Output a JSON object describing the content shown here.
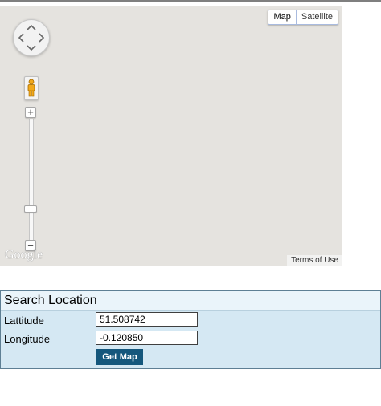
{
  "map": {
    "type_buttons": {
      "map_label": "Map",
      "satellite_label": "Satellite",
      "selected": "Map"
    },
    "logo_text": "Google",
    "terms_label": "Terms of Use",
    "zoom": {
      "plus_label": "+",
      "minus_label": "−",
      "level": 0.3
    },
    "colors": {
      "background": "#e5e3df"
    }
  },
  "search": {
    "title": "Search Location",
    "latitude": {
      "label": "Lattitude",
      "value": "51.508742"
    },
    "longitude": {
      "label": "Longitude",
      "value": "-0.120850"
    },
    "submit_label": "Get Map",
    "colors": {
      "panel_bg": "#d5e8f3",
      "button_bg": "#15577c",
      "border": "#5e7f94"
    }
  }
}
